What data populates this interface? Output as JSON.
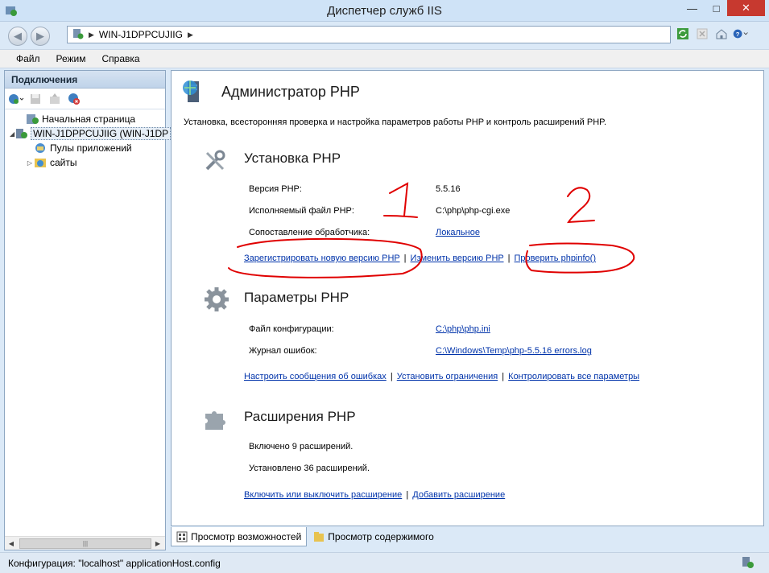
{
  "window": {
    "title": "Диспетчер служб IIS",
    "min_glyph": "—",
    "max_glyph": "□",
    "close_glyph": "✕"
  },
  "address": {
    "separator": "▶",
    "segments": [
      "WIN-J1DPPCUJIIG"
    ]
  },
  "nav": {
    "back_glyph": "◀",
    "forward_glyph": "▶"
  },
  "toolbar_right": {
    "icons": [
      "refresh-icon",
      "stop-icon",
      "home-icon",
      "help-icon"
    ],
    "help_glyph": "❓"
  },
  "menu": [
    "Файл",
    "Режим",
    "Справка"
  ],
  "connections": {
    "header": "Подключения",
    "tools": [
      "connect-icon",
      "save-icon",
      "up-icon",
      "disconnect-icon"
    ],
    "tree": [
      {
        "label": "Начальная страница",
        "indent": 0,
        "twisty": "",
        "icon": "start-page-icon"
      },
      {
        "label": "WIN-J1DPPCUJIIG (WIN-J1DP",
        "indent": 0,
        "twisty": "◢",
        "icon": "server-icon",
        "selected": true
      },
      {
        "label": "Пулы приложений",
        "indent": 1,
        "twisty": "",
        "icon": "app-pools-icon"
      },
      {
        "label": "сайты",
        "indent": 1,
        "twisty": "▷",
        "icon": "sites-icon"
      }
    ],
    "scroll_left": "◀",
    "scroll_right": "▶",
    "scroll_grip": "|||"
  },
  "main": {
    "title": "Администратор PHP",
    "description": "Установка, всесторонняя проверка и настройка параметров работы PHP и контроль расширений PHP.",
    "install": {
      "title": "Установка PHP",
      "version_label": "Версия PHP:",
      "version_value": "5.5.16",
      "exe_label": "Исполняемый файл PHP:",
      "exe_value": "C:\\php\\php-cgi.exe",
      "handler_label": "Сопоставление обработчика:",
      "handler_value": "Локальное",
      "links": [
        "Зарегистрировать новую версию PHP",
        "Изменить версию PHP",
        "Проверить phpinfo()"
      ]
    },
    "params": {
      "title": "Параметры PHP",
      "config_label": "Файл конфигурации:",
      "config_value": "C:\\php\\php.ini",
      "errlog_label": "Журнал ошибок:",
      "errlog_value": "C:\\Windows\\Temp\\php-5.5.16 errors.log",
      "links": [
        "Настроить сообщения об ошибках",
        "Установить ограничения",
        "Контролировать все параметры"
      ]
    },
    "extensions": {
      "title": "Расширения PHP",
      "enabled": "Включено 9 расширений.",
      "installed": "Установлено 36 расширений.",
      "links": [
        "Включить или выключить расширение",
        "Добавить расширение"
      ]
    },
    "link_separator": "|"
  },
  "annotations": {
    "mark1": "1",
    "mark2": "2",
    "color": "#e00000"
  },
  "view_tabs": [
    {
      "label": "Просмотр возможностей",
      "active": true
    },
    {
      "label": "Просмотр содержимого",
      "active": false
    }
  ],
  "status": {
    "text": "Конфигурация: \"localhost\" applicationHost.config"
  }
}
